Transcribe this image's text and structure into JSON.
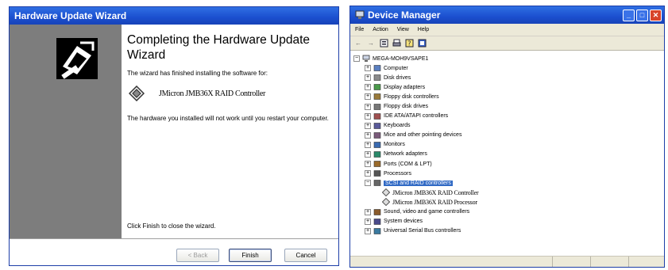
{
  "wizard": {
    "title": "Hardware Update Wizard",
    "heading": "Completing the Hardware Update Wizard",
    "finished_text": "The wizard has finished installing the software for:",
    "device_name": "JMicron JMB36X RAID Controller",
    "warning_text": "The hardware you installed will not work until you restart your computer.",
    "finish_instruction": "Click Finish to close the wizard.",
    "buttons": {
      "back": "< Back",
      "finish": "Finish",
      "cancel": "Cancel"
    }
  },
  "device_manager": {
    "title": "Device Manager",
    "menu": [
      "File",
      "Action",
      "View",
      "Help"
    ],
    "toolbar_icons": [
      "back-arrow-icon",
      "forward-arrow-icon",
      "properties-icon",
      "print-icon",
      "help-icon",
      "scan-icon"
    ],
    "root": "MEGA-MOH9VSAPE1",
    "nodes": [
      {
        "label": "Computer",
        "icon": "computer-icon"
      },
      {
        "label": "Disk drives",
        "icon": "disk-drive-icon"
      },
      {
        "label": "Display adapters",
        "icon": "display-adapter-icon"
      },
      {
        "label": "Floppy disk controllers",
        "icon": "floppy-controller-icon"
      },
      {
        "label": "Floppy disk drives",
        "icon": "floppy-drive-icon"
      },
      {
        "label": "IDE ATA/ATAPI controllers",
        "icon": "ide-controller-icon"
      },
      {
        "label": "Keyboards",
        "icon": "keyboard-icon"
      },
      {
        "label": "Mice and other pointing devices",
        "icon": "mouse-icon"
      },
      {
        "label": "Monitors",
        "icon": "monitor-icon"
      },
      {
        "label": "Network adapters",
        "icon": "network-adapter-icon"
      },
      {
        "label": "Ports (COM & LPT)",
        "icon": "port-icon"
      },
      {
        "label": "Processors",
        "icon": "processor-icon"
      },
      {
        "label": "SCSI and RAID controllers",
        "icon": "scsi-icon",
        "expanded": true,
        "selected": true,
        "children": [
          "JMicron JMB36X RAID Controller",
          "JMicron JMB36X RAID Processor"
        ]
      },
      {
        "label": "Sound, video and game controllers",
        "icon": "sound-icon"
      },
      {
        "label": "System devices",
        "icon": "system-device-icon"
      },
      {
        "label": "Universal Serial Bus controllers",
        "icon": "usb-icon"
      }
    ]
  }
}
